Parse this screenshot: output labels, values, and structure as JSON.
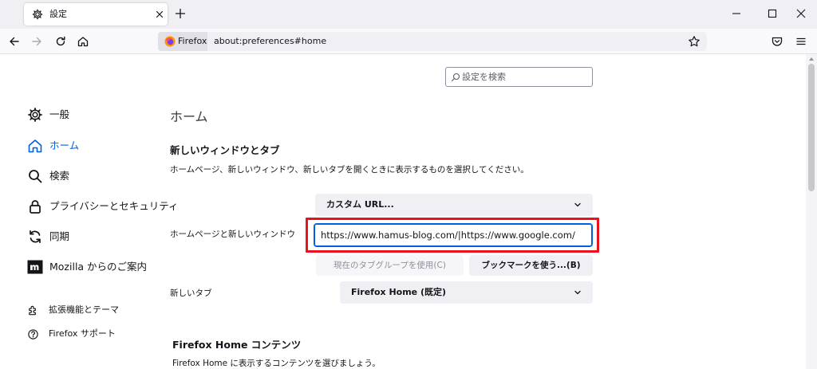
{
  "tabbar": {
    "tab_title": "設定",
    "tab_icon": "gear-icon"
  },
  "navbar": {
    "identity_label": "Firefox",
    "url": "about:preferences#home"
  },
  "search": {
    "placeholder": "設定を検索"
  },
  "sidebar": {
    "categories": [
      {
        "label": "一般",
        "icon": "gear-icon"
      },
      {
        "label": "ホーム",
        "icon": "home-icon",
        "active": true
      },
      {
        "label": "検索",
        "icon": "search-icon"
      },
      {
        "label": "プライバシーとセキュリティ",
        "icon": "lock-icon"
      },
      {
        "label": "同期",
        "icon": "sync-icon"
      },
      {
        "label": "Mozilla からのご案内",
        "icon": "mozilla-icon"
      }
    ],
    "footer": [
      {
        "label": "拡張機能とテーマ",
        "icon": "puzzle-icon"
      },
      {
        "label": "Firefox サポート",
        "icon": "help-icon"
      }
    ]
  },
  "main": {
    "title": "ホーム",
    "section_title": "新しいウィンドウとタブ",
    "section_desc": "ホームページ、新しいウィンドウ、新しいタブを開くときに表示するものを選択してください。",
    "homepage_label": "ホームページと新しいウィンドウ",
    "homepage_mode": "カスタム URL...",
    "homepage_url": "https://www.hamus-blog.com/|https://www.google.com/",
    "use_current_pages_button": "現在のタブグループを使用(C)",
    "use_bookmark_button": "ブックマークを使う...(B)",
    "newtab_label": "新しいタブ",
    "newtab_mode": "Firefox Home (既定)",
    "fxhome_title": "Firefox Home コンテンツ",
    "fxhome_desc": "Firefox Home に表示するコンテンツを選びましょう。"
  },
  "colors": {
    "accent": "#0061e0",
    "highlight_box": "#e8131f"
  }
}
